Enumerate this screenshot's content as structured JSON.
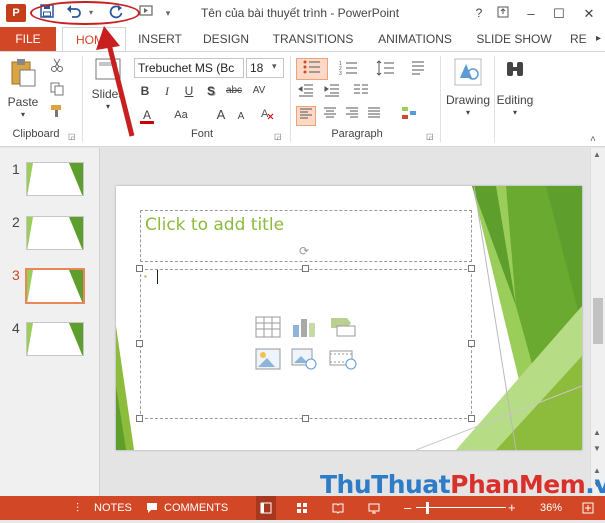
{
  "window": {
    "title": "Tên của bài thuyết trình - PowerPoint",
    "logo_letter": "P",
    "help_label": "?",
    "minimize_label": "–",
    "restore_label": "☐",
    "close_label": "✕"
  },
  "qat": {
    "save_icon": "save-icon",
    "undo_icon": "undo-icon",
    "redo_icon": "redo-icon"
  },
  "tabs": [
    {
      "label": "FILE"
    },
    {
      "label": "HOME"
    },
    {
      "label": "INSERT"
    },
    {
      "label": "DESIGN"
    },
    {
      "label": "TRANSITIONS"
    },
    {
      "label": "ANIMATIONS"
    },
    {
      "label": "SLIDE SHOW"
    },
    {
      "label": "RE"
    }
  ],
  "ribbon": {
    "paste_label": "Paste",
    "slides_label": "Slides",
    "font_name": "Trebuchet MS (Bc",
    "font_size": "18",
    "drawing_label": "Drawing",
    "editing_label": "Editing",
    "groups": {
      "clipboard": "Clipboard",
      "font": "Font",
      "paragraph": "Paragraph"
    },
    "format_buttons": {
      "bold": "B",
      "italic": "I",
      "underline": "U",
      "shadow": "S",
      "strike": "abc",
      "spacing": "AV",
      "color": "A",
      "aa": "Aa",
      "grow": "A",
      "shrink": "A"
    }
  },
  "thumbnails": [
    {
      "number": "1"
    },
    {
      "number": "2"
    },
    {
      "number": "3"
    },
    {
      "number": "4"
    }
  ],
  "slide": {
    "title_placeholder": "Click to add title"
  },
  "statusbar": {
    "notes": "NOTES",
    "comments": "COMMENTS",
    "zoom": "36%",
    "minus": "–",
    "plus": "+"
  },
  "watermark": {
    "part1": "ThuThuat",
    "part2": "PhanMem",
    "part3": ".vn"
  },
  "colors": {
    "accent": "#d24726",
    "annotation": "#c8201e",
    "slide_green": "#8dbb3c"
  }
}
